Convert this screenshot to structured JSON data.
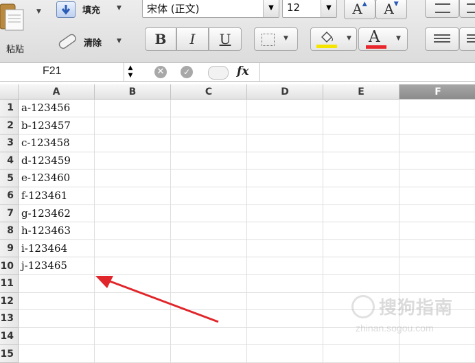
{
  "toolbar": {
    "paste_label": "粘贴",
    "fill_label": "填充",
    "clear_label": "清除",
    "font_name": "宋体 (正文)",
    "font_size": "12",
    "bold": "B",
    "italic": "I",
    "underline": "U",
    "font_color_glyph": "A",
    "font_color": "#e8262b",
    "fill_color": "#f5e400"
  },
  "formula_bar": {
    "name_box": "F21",
    "fx": "fx",
    "content": ""
  },
  "sheet": {
    "columns": [
      "A",
      "B",
      "C",
      "D",
      "E",
      "F"
    ],
    "rows": [
      "1",
      "2",
      "3",
      "4",
      "5",
      "6",
      "7",
      "8",
      "9",
      "10",
      "11",
      "12",
      "13",
      "14",
      "15"
    ],
    "column_a_values": [
      "a-123456",
      "b-123457",
      "c-123458",
      "d-123459",
      "e-123460",
      "f-123461",
      "g-123462",
      "h-123463",
      "i-123464",
      "j-123465"
    ],
    "selected_column": "F"
  },
  "annotation": {
    "arrow_color": "#e0262b"
  },
  "watermark": {
    "text": "搜狗指南",
    "url": "zhinan.sogou.com"
  }
}
